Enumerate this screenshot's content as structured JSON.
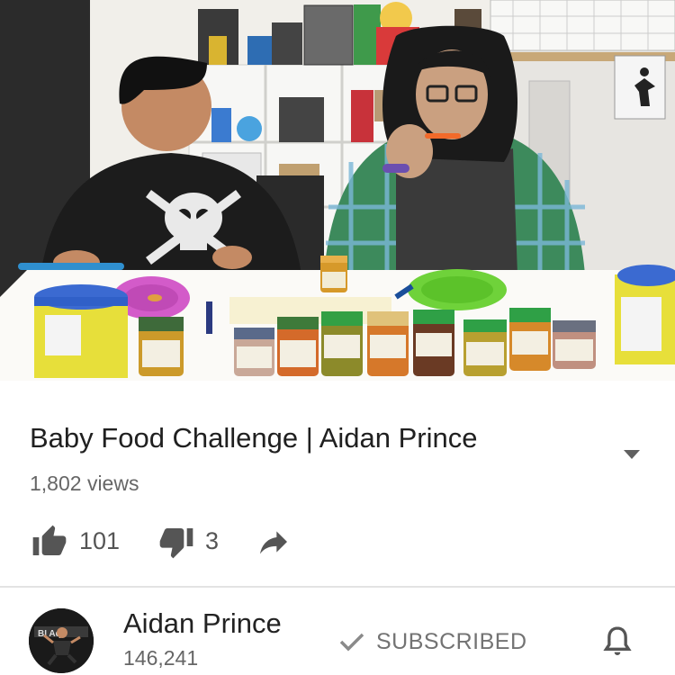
{
  "video": {
    "thumbnail_icon": "video-frame-image"
  },
  "title": "Baby Food Challenge | Aidan Prince",
  "views": "1,802 views",
  "actions": {
    "like_count": "101",
    "dislike_count": "3",
    "like_icon": "thumbs-up-icon",
    "dislike_icon": "thumbs-down-icon",
    "share_icon": "share-arrow-icon"
  },
  "channel": {
    "name": "Aidan Prince",
    "subscribers": "146,241",
    "avatar_text": "BI  ...",
    "subscribed_label": "SUBSCRIBED",
    "bell_icon": "notification-bell-icon"
  },
  "colors": {
    "text_primary": "#202020",
    "text_secondary": "#666666",
    "icon_grey": "#555555"
  }
}
